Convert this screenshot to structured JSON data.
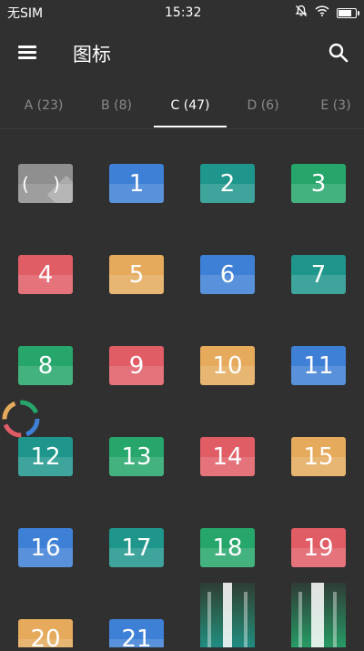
{
  "status_bar": {
    "carrier": "无SIM",
    "time": "15:32"
  },
  "app_bar": {
    "title": "图标"
  },
  "tabs": [
    {
      "label": "A (23)"
    },
    {
      "label": "B (8)"
    },
    {
      "label": "C (47)"
    },
    {
      "label": "D (6)"
    },
    {
      "label": "E (3)"
    }
  ],
  "active_tab": "C (47)",
  "colors": {
    "background": "#303030",
    "gray": "#8f8f8f",
    "blue": "#3e80d6",
    "teal": "#1f968c",
    "green": "#26a66b",
    "red": "#e05d66",
    "orange": "#e5aa5c"
  },
  "tiles": [
    {
      "label": "( )",
      "color": "gray"
    },
    {
      "label": "1",
      "color": "blue"
    },
    {
      "label": "2",
      "color": "teal"
    },
    {
      "label": "3",
      "color": "green"
    },
    {
      "label": "4",
      "color": "red"
    },
    {
      "label": "5",
      "color": "orange"
    },
    {
      "label": "6",
      "color": "blue"
    },
    {
      "label": "7",
      "color": "teal"
    },
    {
      "label": "8",
      "color": "green"
    },
    {
      "label": "9",
      "color": "red"
    },
    {
      "label": "10",
      "color": "orange"
    },
    {
      "label": "11",
      "color": "blue"
    },
    {
      "label": "12",
      "color": "teal"
    },
    {
      "label": "13",
      "color": "green"
    },
    {
      "label": "14",
      "color": "red"
    },
    {
      "label": "15",
      "color": "orange"
    },
    {
      "label": "16",
      "color": "blue"
    },
    {
      "label": "17",
      "color": "teal"
    },
    {
      "label": "18",
      "color": "green"
    },
    {
      "label": "19",
      "color": "red"
    },
    {
      "label": "20",
      "color": "orange"
    },
    {
      "label": "21",
      "color": "blue"
    }
  ]
}
